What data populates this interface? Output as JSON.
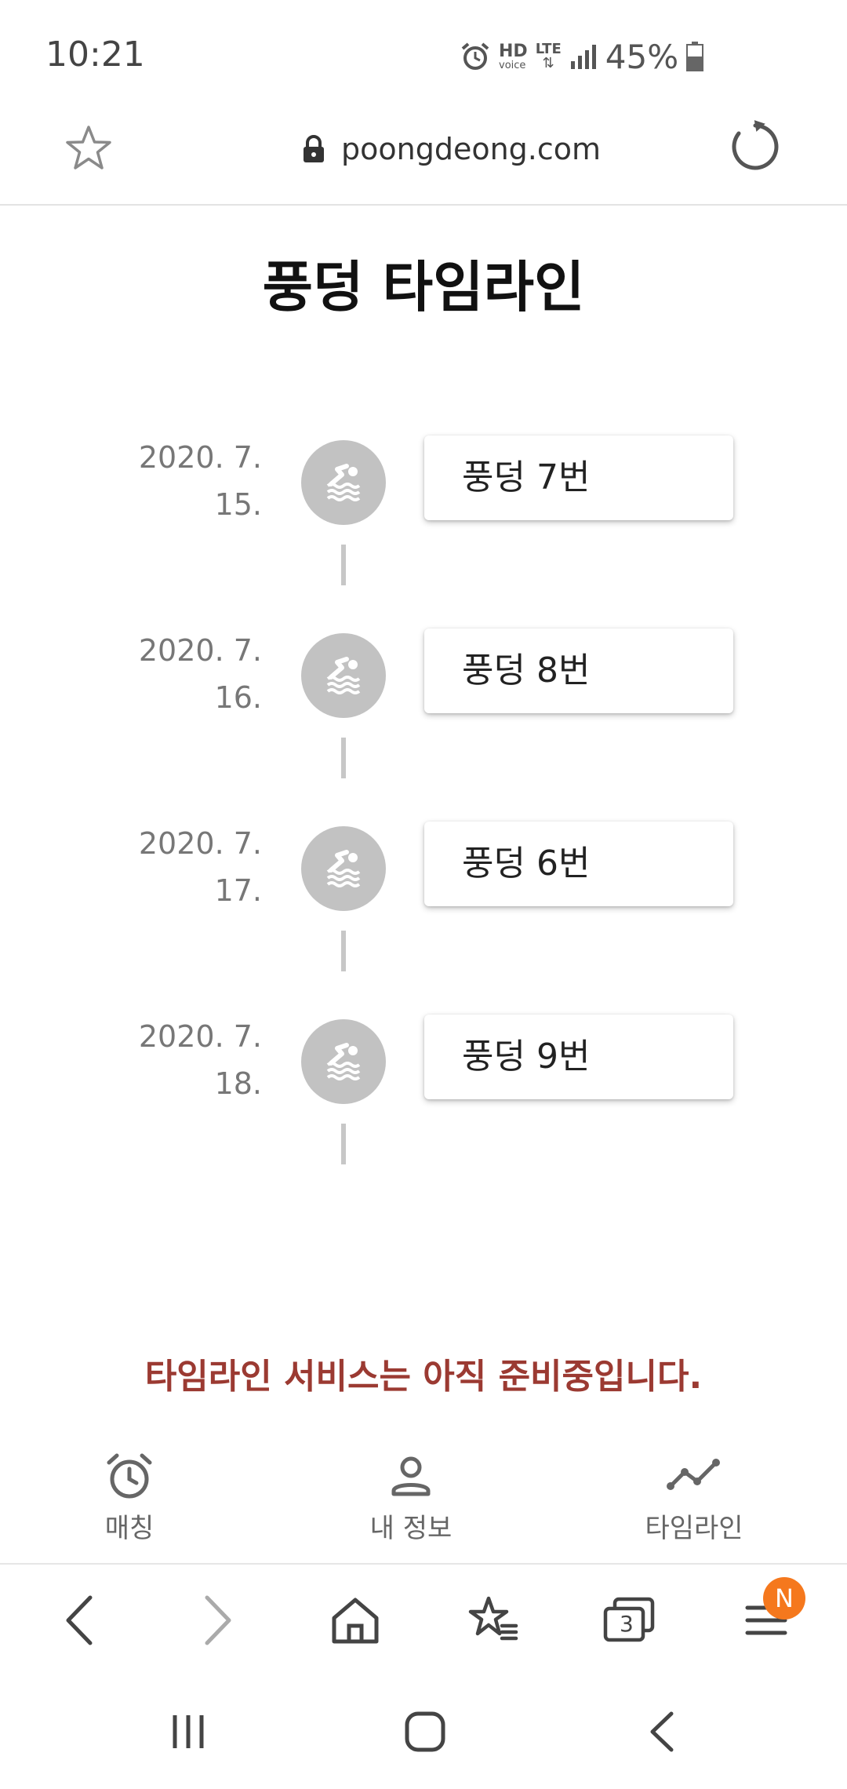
{
  "status_bar": {
    "time": "10:21",
    "hd_label": "HD",
    "voice_label": "voice",
    "lte_label": "LTE",
    "battery": "45%"
  },
  "browser": {
    "url": "poongdeong.com",
    "tabs_count": "3",
    "menu_badge": "N"
  },
  "page": {
    "title": "풍덩 타임라인",
    "timeline": [
      {
        "date_line1": "2020. 7.",
        "date_line2": "15.",
        "label": "풍덩 7번"
      },
      {
        "date_line1": "2020. 7.",
        "date_line2": "16.",
        "label": "풍덩 8번"
      },
      {
        "date_line1": "2020. 7.",
        "date_line2": "17.",
        "label": "풍덩 6번"
      },
      {
        "date_line1": "2020. 7.",
        "date_line2": "18.",
        "label": "풍덩 9번"
      }
    ],
    "notice": "타임라인 서비스는 아직 준비중입니다."
  },
  "app_nav": {
    "items": [
      {
        "label": "매칭",
        "icon": "alarm-clock-icon"
      },
      {
        "label": "내 정보",
        "icon": "person-icon"
      },
      {
        "label": "타임라인",
        "icon": "trend-line-icon"
      }
    ]
  },
  "colors": {
    "notice": "#9b3a32",
    "badge": "#f5781d",
    "dot": "#c2c2c2"
  }
}
